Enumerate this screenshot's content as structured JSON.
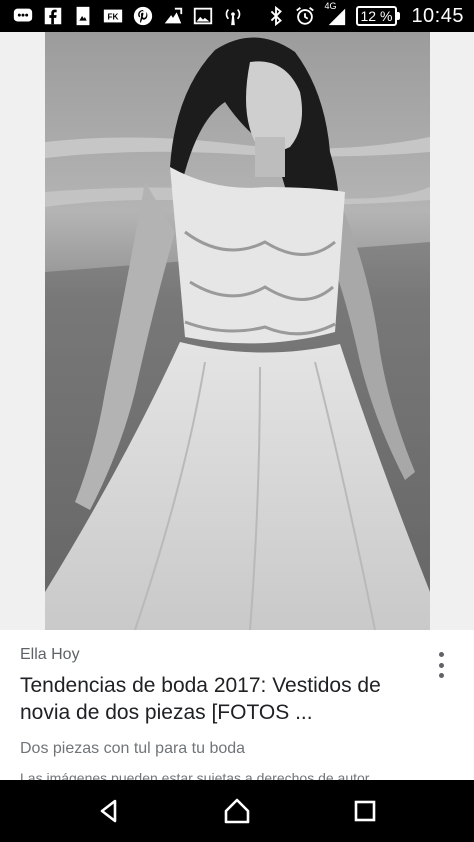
{
  "status_bar": {
    "left_icons": [
      "message-icon",
      "facebook-icon",
      "image-icon",
      "fk-icon",
      "pinterest-icon",
      "photos-icon",
      "gallery-icon",
      "hotspot-icon"
    ],
    "network_label": "4G",
    "battery": "12 %",
    "time": "10:45"
  },
  "card": {
    "source": "Ella Hoy",
    "title": "Tendencias de boda 2017: Vestidos de novia de dos piezas [FOTOS ...",
    "subtitle": "Dos piezas con tul para tu boda",
    "disclaimer": "Las imágenes pueden estar sujetas a derechos de autor."
  },
  "nav_bar": {
    "buttons": [
      "back-icon",
      "home-icon",
      "recents-icon"
    ]
  },
  "colors": {
    "status_bar_bg": "#000000",
    "nav_bar_bg": "#000000",
    "source_text": "#5f6368",
    "title_text": "#202124"
  }
}
